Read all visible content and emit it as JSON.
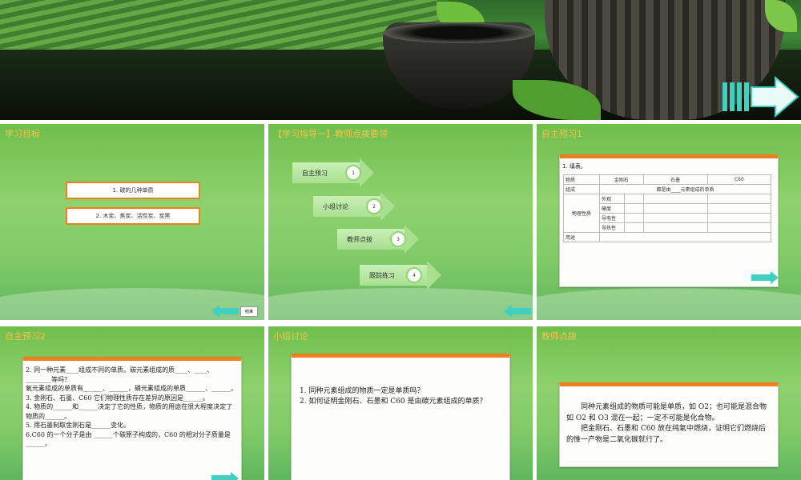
{
  "banner": {
    "colors": {
      "dark": "#0c1a0b",
      "accent": "#3fd0c0"
    }
  },
  "slides": {
    "s1": {
      "title": "学习目标",
      "items": [
        "1. 碳的几种单质",
        "2. 木炭、焦炭、活性炭、炭黑"
      ],
      "back_label": "结束"
    },
    "s2": {
      "title": "【学习指导一】教师点拨要领",
      "steps": [
        {
          "label": "自主预习",
          "num": "1"
        },
        {
          "label": "小组讨论",
          "num": "2"
        },
        {
          "label": "教师点拨",
          "num": "3"
        },
        {
          "label": "跟踪练习",
          "num": "4"
        }
      ]
    },
    "s3": {
      "title": "自主预习1",
      "heading": "1. 填表。",
      "table": {
        "cols": [
          "物质",
          "金刚石",
          "石墨",
          "C60"
        ],
        "composition_label": "组成",
        "composition_value": "都是由____元素组成的单质",
        "phys_label": "物理性质",
        "phys_rows": [
          "外观",
          "硬度",
          "导电性",
          "导热性"
        ],
        "use_label": "用途"
      }
    },
    "s4": {
      "title": "自主预习2",
      "lines": [
        "2. 同一种元素____组成不同的单质。碳元素组成的质____、____、________等吗？",
        "氧元素组成的单质有______、______，磷元素组成的单质______、______。",
        "3. 金刚石、石墨、C60 它们物理性质存在差异的原因是______。",
        "4. 物质的______和______决定了它的性质，物质的用途在很大程度决定了物质的______。",
        "5. 用石墨制取金刚石是______变化。",
        "6.C60 的一个分子是由 ______个碳原子构成的，C60 的相对分子质量是______。"
      ]
    },
    "s5": {
      "title": "小组讨论",
      "lines": [
        "1. 同种元素组成的物质一定是单质吗？",
        "2. 如何证明金刚石、石墨和 C60 是由碳元素组成的单质？"
      ]
    },
    "s6": {
      "title": "教师点拨",
      "lines": [
        "同种元素组成的物质可能是单质，如 O2；也可能是混合物如 O2 和 O3 混在一起；一定不可能是化合物。",
        "把金刚石、石墨和 C60 放在纯氧中燃烧，证明它们燃烧后的惟一产物是二氧化碳就行了。"
      ]
    }
  }
}
